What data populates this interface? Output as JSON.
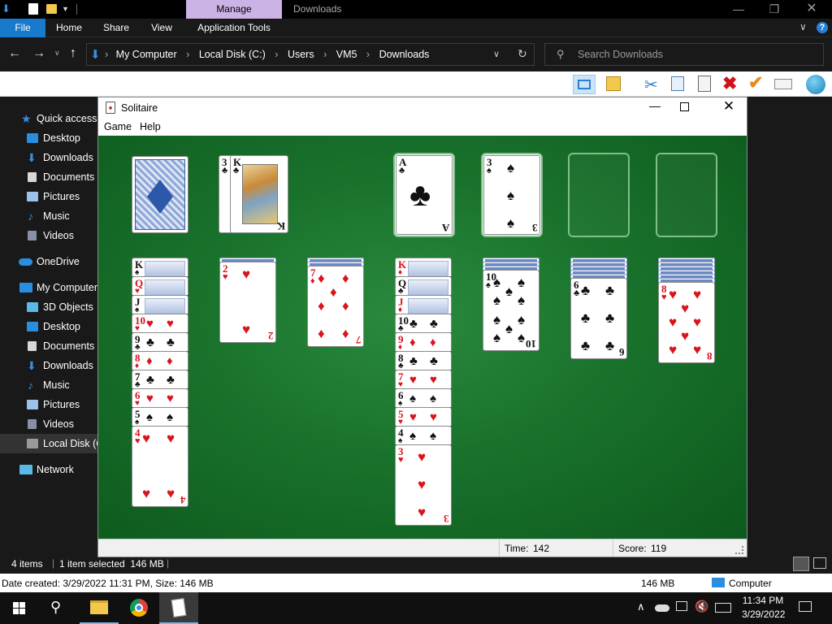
{
  "explorer": {
    "context_tab": "Manage",
    "window_title": "Downloads",
    "tabs": [
      "File",
      "Home",
      "Share",
      "View",
      "Application Tools"
    ],
    "path": [
      "My Computer",
      "Local Disk (C:)",
      "Users",
      "VM5",
      "Downloads"
    ],
    "search_placeholder": "Search Downloads",
    "nav": {
      "quick_access": "Quick access",
      "quick_items": [
        "Desktop",
        "Downloads",
        "Documents",
        "Pictures",
        "Music",
        "Videos"
      ],
      "onedrive": "OneDrive",
      "my_computer": "My Computer",
      "computer_items": [
        "3D Objects",
        "Desktop",
        "Documents",
        "Downloads",
        "Music",
        "Pictures",
        "Videos",
        "Local Disk (C:)"
      ],
      "network": "Network"
    },
    "status": {
      "items": "4 items",
      "selected": "1 item selected  146 MB"
    },
    "details": {
      "info": "Date created: 3/29/2022 11:31 PM, Size: 146 MB",
      "size": "146 MB",
      "location": "Computer"
    }
  },
  "solitaire": {
    "title": "Solitaire",
    "menu": [
      "Game",
      "Help"
    ],
    "time_label": "Time:",
    "time_value": "142",
    "score_label": "Score:",
    "score_value": "119",
    "waste": [
      "3♣",
      "K♣"
    ],
    "foundations": [
      "A♣",
      "3♠",
      "",
      ""
    ],
    "tableau": [
      {
        "hidden": 0,
        "cards": [
          "K♠",
          "Q♥",
          "J♠",
          "10♥",
          "9♣",
          "8♦",
          "7♣",
          "6♥",
          "5♠",
          "4♥"
        ]
      },
      {
        "hidden": 1,
        "cards": [
          "2♥"
        ]
      },
      {
        "hidden": 2,
        "cards": [
          "7♦"
        ]
      },
      {
        "hidden": 0,
        "cards": [
          "K♦",
          "Q♣",
          "J♦",
          "10♣",
          "9♦",
          "8♣",
          "7♥",
          "6♠",
          "5♥",
          "4♠",
          "3♥"
        ]
      },
      {
        "hidden": 3,
        "cards": [
          "10♠"
        ]
      },
      {
        "hidden": 5,
        "cards": [
          "6♣"
        ]
      },
      {
        "hidden": 6,
        "cards": [
          "8♥"
        ]
      }
    ]
  },
  "taskbar": {
    "time": "11:34 PM",
    "date": "3/29/2022"
  },
  "colors": {
    "felt": "#19722c",
    "accent": "#0078d7",
    "manage_tab": "#ccb3e6"
  }
}
